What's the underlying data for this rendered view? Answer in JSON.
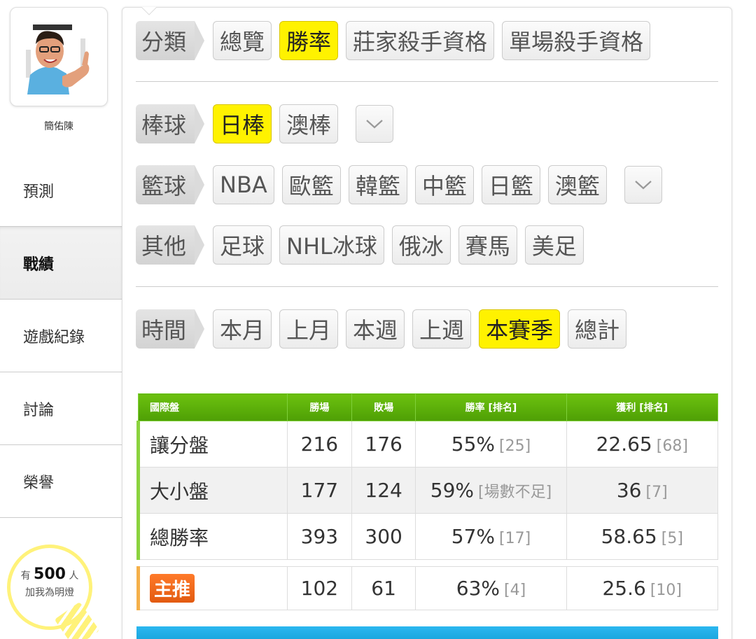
{
  "user": {
    "name": "簡佑陳"
  },
  "nav": {
    "items": [
      {
        "label": "預測"
      },
      {
        "label": "戰績"
      },
      {
        "label": "遊戲紀錄"
      },
      {
        "label": "討論"
      },
      {
        "label": "榮譽"
      }
    ],
    "active_index": 1
  },
  "fans": {
    "prefix": "有",
    "count": "500",
    "suffix": "人",
    "line2": "加我為明燈"
  },
  "filters": {
    "category": {
      "label": "分類",
      "options": [
        "總覽",
        "勝率",
        "莊家殺手資格",
        "單場殺手資格"
      ],
      "selected": "勝率"
    },
    "baseball": {
      "label": "棒球",
      "options": [
        "日棒",
        "澳棒"
      ],
      "selected": "日棒"
    },
    "basketball": {
      "label": "籃球",
      "options": [
        "NBA",
        "歐籃",
        "韓籃",
        "中籃",
        "日籃",
        "澳籃"
      ]
    },
    "other": {
      "label": "其他",
      "options": [
        "足球",
        "NHL冰球",
        "俄冰",
        "賽馬",
        "美足"
      ]
    },
    "time": {
      "label": "時間",
      "options": [
        "本月",
        "上月",
        "本週",
        "上週",
        "本賽季",
        "總計"
      ],
      "selected": "本賽季"
    }
  },
  "table": {
    "headers": [
      "國際盤",
      "勝場",
      "敗場",
      "勝率 [排名]",
      "獲利 [排名]"
    ],
    "rows": [
      {
        "name": "讓分盤",
        "wins": "216",
        "losses": "176",
        "rate": "55%",
        "rate_rank": "[25]",
        "profit": "22.65",
        "profit_rank": "[68]"
      },
      {
        "name": "大小盤",
        "wins": "177",
        "losses": "124",
        "rate": "59%",
        "rate_rank": "[場數不足]",
        "profit": "36",
        "profit_rank": "[7]"
      },
      {
        "name": "總勝率",
        "wins": "393",
        "losses": "300",
        "rate": "57%",
        "rate_rank": "[17]",
        "profit": "58.65",
        "profit_rank": "[5]"
      }
    ],
    "main": {
      "badge": "主推",
      "wins": "102",
      "losses": "61",
      "rate": "63%",
      "rate_rank": "[4]",
      "profit": "25.6",
      "profit_rank": "[10]"
    }
  },
  "colors": {
    "selected": "#fff200",
    "table_header": "#5aae09",
    "accent_badge": "#f06a1c",
    "next_header": "#22aee8"
  }
}
